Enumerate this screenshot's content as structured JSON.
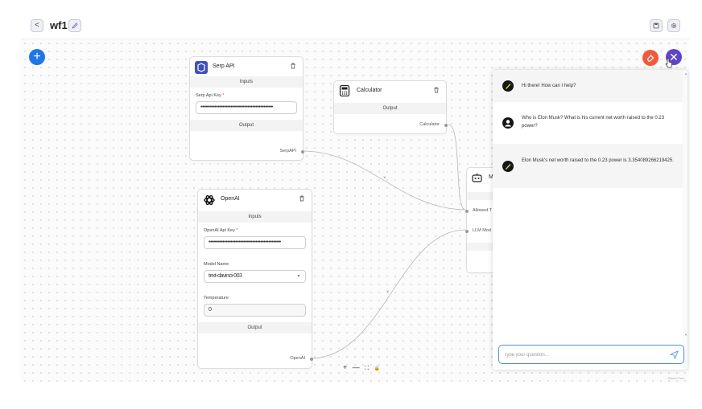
{
  "header": {
    "back_label": "<",
    "flow_name": "wf1"
  },
  "nodes": {
    "serp": {
      "title": "Serp API",
      "inputs_label": "Inputs",
      "field_label": "Serp Api Key",
      "required_mark": "*",
      "field_value": "••••••••••••••••••••••••••••••••••••••••••••••",
      "output_label": "Output",
      "output_port": "SerpAPI"
    },
    "calculator": {
      "title": "Calculator",
      "output_label": "Output",
      "output_port": "Calculator"
    },
    "openai": {
      "title": "OpenAI",
      "inputs_label": "Inputs",
      "api_key_label": "OpenAI Api Key",
      "required_mark": "*",
      "api_key_value": "••••••••••••••••••••••••••••••••••••••••••••••",
      "model_label": "Model Name",
      "model_value": "text-davinci-003",
      "temperature_label": "Temperature",
      "temperature_value": "0",
      "output_label": "Output",
      "output_port": "OpenAI"
    },
    "agent": {
      "title_partial": "M",
      "input_tools": "Allowed T",
      "input_llm": "LLM Mod"
    }
  },
  "controls": {
    "zoom_in": "+",
    "zoom_out": "—",
    "fit": "⛶",
    "lock": "🔒"
  },
  "chat": {
    "messages": [
      {
        "role": "bot",
        "text": "Hi there! How can I help?"
      },
      {
        "role": "user",
        "text": "Who is Elon Musk? What is his current net worth raised to the 0.23 power?"
      },
      {
        "role": "bot",
        "text": "Elon Musk's net worth raised to the 0.23 power is 3.354089266219425."
      }
    ],
    "input_placeholder": "Type your question..."
  },
  "attribution": "React Flow",
  "colors": {
    "add_button": "#1f77e6",
    "clear_button": "#ef5a3a",
    "close_button": "#5e44c9",
    "input_focus": "#4a8fe4"
  }
}
